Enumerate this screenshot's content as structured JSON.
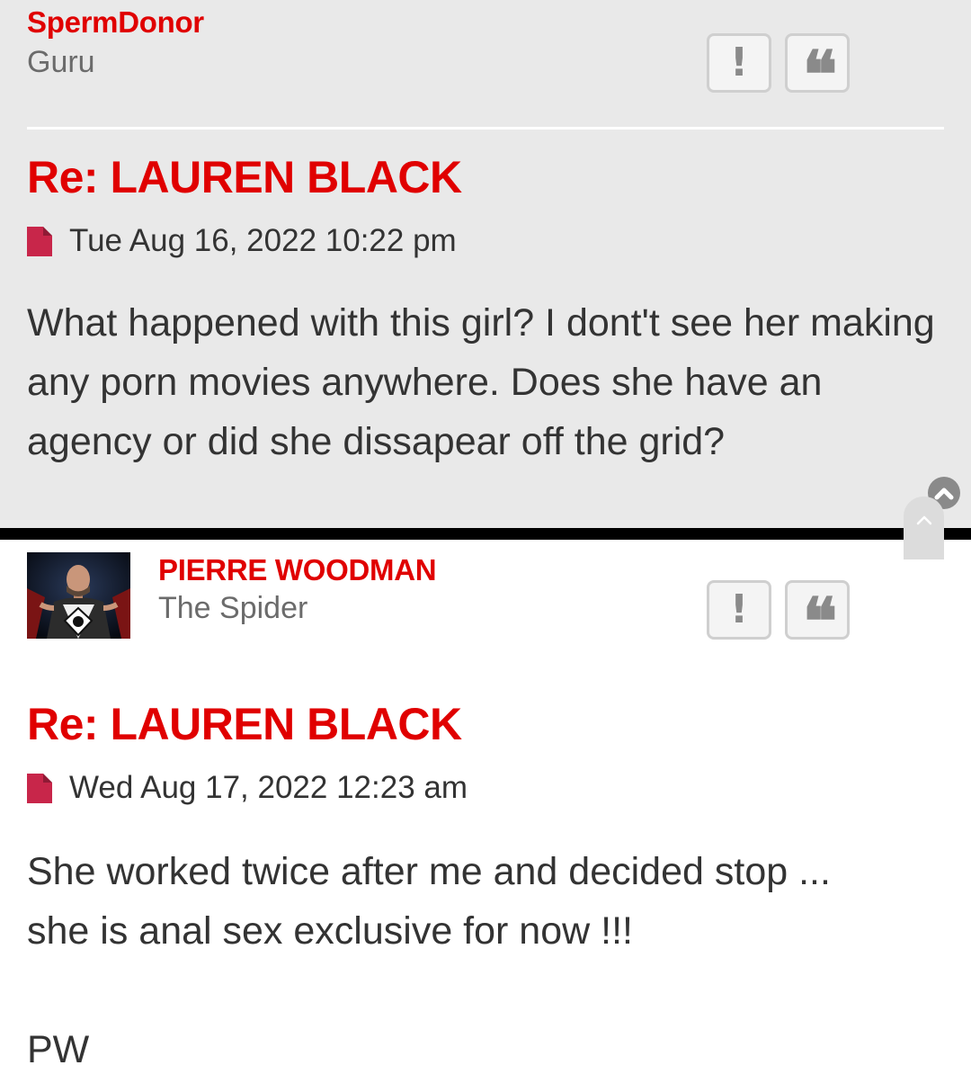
{
  "posts": [
    {
      "username": "SpermDonor",
      "rank": "Guru",
      "report_label": "!",
      "quote_label": "❝",
      "title": "Re: LAUREN BLACK",
      "date": "Tue Aug 16, 2022 10:22 pm",
      "body": "What happened with this girl? I dont't see her making any porn movies anywhere. Does she have an agency or did she dissapear off the grid?"
    },
    {
      "username": "PIERRE WOODMAN",
      "rank": "The Spider",
      "report_label": "!",
      "quote_label": "❝",
      "title": "Re: LAUREN BLACK",
      "date": "Wed Aug 17, 2022 12:23 am",
      "body_line1": "She worked twice after me and decided stop ...",
      "body_line2": "she is anal sex exclusive for now !!!",
      "signature": "PW"
    }
  ],
  "icons": {
    "post_icon": "document-icon",
    "report": "exclamation-icon",
    "quote": "quote-icon",
    "back_to_top": "chevron-up-circle-icon",
    "scroll_fab": "chevron-up-icon"
  },
  "colors": {
    "username": "#e00000",
    "title": "#e00000",
    "post_icon": "#c8264a",
    "post1_bg": "#e9e9e9",
    "post2_bg": "#ffffff"
  }
}
